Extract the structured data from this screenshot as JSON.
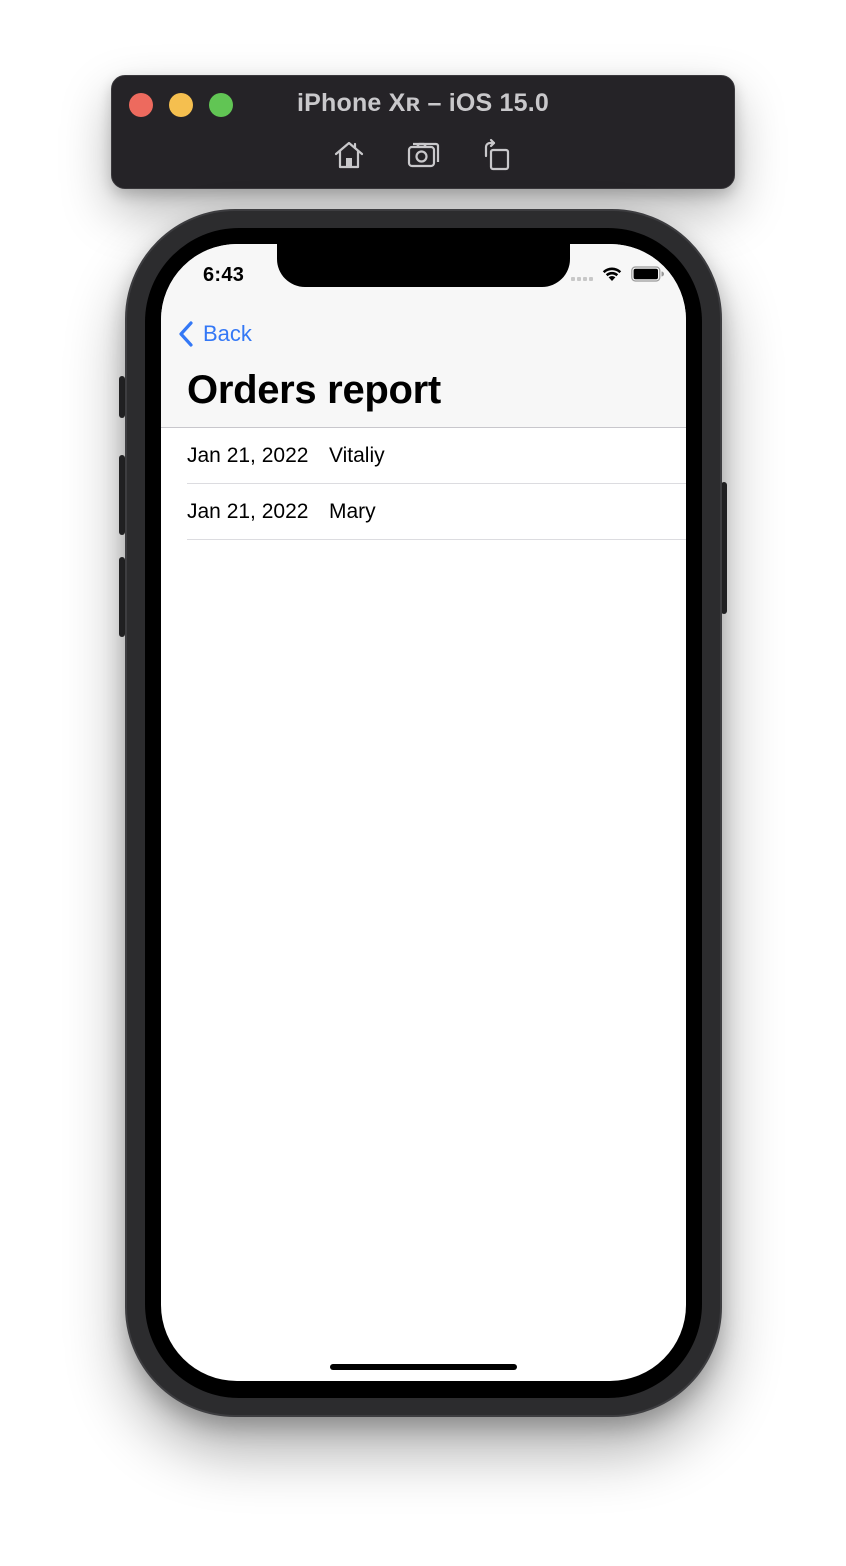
{
  "simulator": {
    "title": "iPhone Xʀ – iOS 15.0",
    "traffic_lights": [
      {
        "name": "close",
        "color": "#ed6a5e"
      },
      {
        "name": "minimize",
        "color": "#f5bf4f"
      },
      {
        "name": "maximize",
        "color": "#61c554"
      }
    ],
    "tools": [
      "home-icon",
      "screenshot-icon",
      "rotate-icon"
    ]
  },
  "status_bar": {
    "time": "6:43"
  },
  "navbar": {
    "back_label": "Back",
    "title": "Orders report",
    "accent_color": "#3478f6"
  },
  "orders": {
    "rows": [
      {
        "date": "Jan 21, 2022",
        "name": "Vitaliy"
      },
      {
        "date": "Jan 21, 2022",
        "name": "Mary"
      }
    ]
  }
}
